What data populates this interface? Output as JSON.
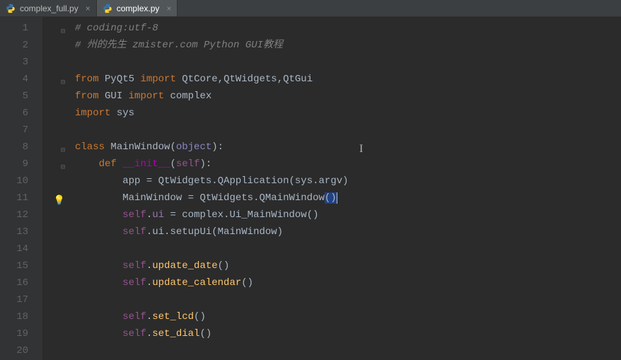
{
  "tabs": [
    {
      "label": "complex_full.py",
      "active": false
    },
    {
      "label": "complex.py",
      "active": true
    }
  ],
  "gutter": {
    "lines": [
      "1",
      "2",
      "3",
      "4",
      "5",
      "6",
      "7",
      "8",
      "9",
      "10",
      "11",
      "12",
      "13",
      "14",
      "15",
      "16",
      "17",
      "18",
      "19",
      "20"
    ]
  },
  "bulb_line": 11,
  "code": {
    "l1": {
      "comment": "# coding:utf-8"
    },
    "l2": {
      "comment": "# 州的先生 zmister.com Python GUI教程"
    },
    "l4": {
      "kw_from": "from",
      "mod1": "PyQt5",
      "kw_import": "import",
      "names": "QtCore,QtWidgets,QtGui"
    },
    "l5": {
      "kw_from": "from",
      "mod1": "GUI",
      "kw_import": "import",
      "names": "complex"
    },
    "l6": {
      "kw_import": "import",
      "names": "sys"
    },
    "l8": {
      "kw_class": "class",
      "name": "MainWindow",
      "base": "object"
    },
    "l9": {
      "kw_def": "def",
      "name": "__init__",
      "param": "self"
    },
    "l10": {
      "lhs": "app",
      "rhs1": "QtWidgets.QApplication",
      "arg": "sys.argv"
    },
    "l11": {
      "lhs": "MainWindow",
      "rhs1": "QtWidgets.QMainWindow"
    },
    "l12": {
      "self": "self",
      "attr": "ui",
      "rhs": "complex.Ui_MainWindow"
    },
    "l13": {
      "self": "self",
      "call": "ui.setupUi",
      "arg": "MainWindow"
    },
    "l15": {
      "self": "self",
      "call": "update_date"
    },
    "l16": {
      "self": "self",
      "call": "update_calendar"
    },
    "l18": {
      "self": "self",
      "call": "set_lcd"
    },
    "l19": {
      "self": "self",
      "call": "set_dial"
    }
  }
}
